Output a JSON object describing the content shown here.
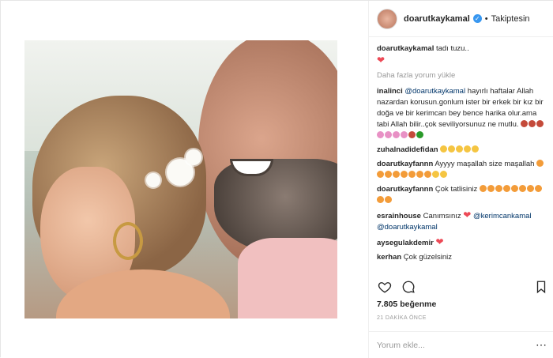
{
  "post": {
    "username": "doarutkaykamal",
    "verified": true,
    "separator": "•",
    "follow_label": "Takiptesin"
  },
  "comments": [
    {
      "user": "doarutkaykamal",
      "text": "tadı tuzu..",
      "emojis": [
        "#ed4956"
      ]
    },
    {
      "more_label": "Daha fazla yorum yükle"
    },
    {
      "user": "inalinci",
      "mention": "@doarutkaykamal",
      "text": "hayırlı haftalar Allah nazardan korusun.gonlum ister bir erkek bir kız bir doğa ve bir kerimcan bey bence harika olur.ama tabi Allah bilir..çok seviliyorsunuz ne mutlu.",
      "emojis": [
        "#c44a3a",
        "#c44a3a",
        "#c44a3a",
        "#e891c5",
        "#e891c5",
        "#e891c5",
        "#e891c5",
        "#c44a3a",
        "#2a9a2a"
      ]
    },
    {
      "user": "zuhalnadidefidan",
      "text": "",
      "emojis": [
        "#f5c542",
        "#f5c542",
        "#f5c542",
        "#f5c542",
        "#f5c542"
      ]
    },
    {
      "user": "doarutkayfannn",
      "text": "Ayyyy maşallah size maşallah",
      "emojis": [
        "#f39c39",
        "#f39c39",
        "#f39c39",
        "#f39c39",
        "#f39c39",
        "#f39c39",
        "#f39c39",
        "#f39c39",
        "#f5c542",
        "#f5c542"
      ]
    },
    {
      "user": "doarutkayfannn",
      "text": "Çok tatlisiniz",
      "emojis": [
        "#f39c39",
        "#f39c39",
        "#f39c39",
        "#f39c39",
        "#f39c39",
        "#f39c39",
        "#f39c39",
        "#f39c39",
        "#f39c39",
        "#f39c39"
      ]
    },
    {
      "user": "esrainhouse",
      "text": "Canımsınız",
      "mention": "@kerimcankamal",
      "mention2": "@doarutkaykamal",
      "emojis": [
        "#ed4956"
      ]
    },
    {
      "user": "aysegulakdemir",
      "text": "",
      "emojis": [
        "#ed4956"
      ]
    },
    {
      "user": "kerhan",
      "text": "Çok güzelsiniz",
      "emojis": []
    }
  ],
  "actions": {
    "like_icon": "heart-icon",
    "comment_icon": "comment-icon",
    "save_icon": "bookmark-icon"
  },
  "likes_text": "7.805 beğenme",
  "time_text": "21 DAKİKA ÖNCE",
  "add_comment": {
    "placeholder": "Yorum ekle...",
    "more_icon": "more-options-icon"
  }
}
